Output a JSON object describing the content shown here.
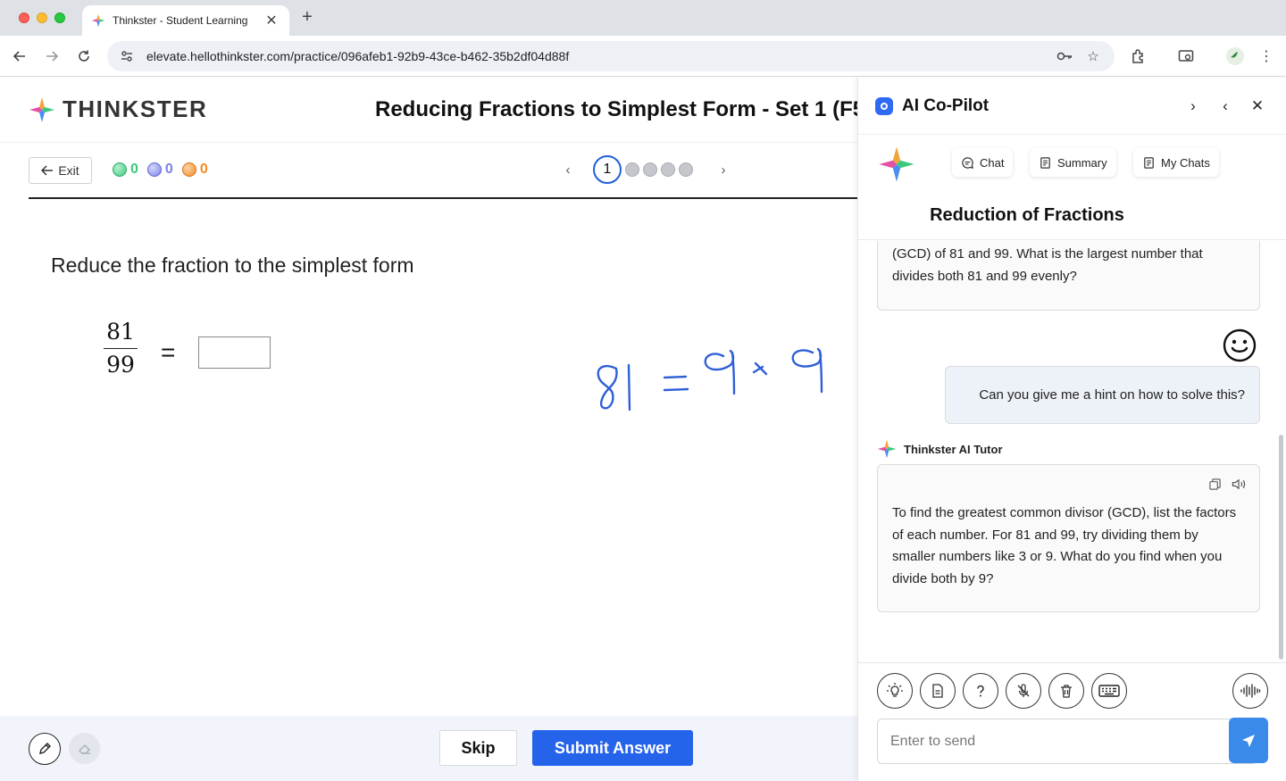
{
  "browser": {
    "tab_title": "Thinkster - Student Learning",
    "url": "elevate.hellothinkster.com/practice/096afeb1-92b9-43ce-b462-35b2df04d88f"
  },
  "header": {
    "logo_text": "THINKSTER",
    "title": "Reducing Fractions to Simplest Form - Set 1 (F5"
  },
  "controls": {
    "exit_label": "Exit",
    "scores": [
      {
        "value": "0",
        "color": "#3cc97b"
      },
      {
        "value": "0",
        "color": "#7b83e8"
      },
      {
        "value": "0",
        "color": "#f28a22"
      }
    ],
    "current_page": "1",
    "total_dots": 4
  },
  "question": {
    "prompt": "Reduce the fraction to the simplest form",
    "numerator": "81",
    "denominator": "99",
    "equals": "="
  },
  "footer": {
    "skip_label": "Skip",
    "submit_label": "Submit Answer"
  },
  "copilot": {
    "title": "AI Co-Pilot",
    "tabs": {
      "chat": "Chat",
      "summary": "Summary",
      "my_chats": "My Chats"
    },
    "conversation_title": "Reduction of Fractions",
    "messages": {
      "ai_first": "(GCD) of 81 and 99. What is the largest number that divides both 81 and 99 evenly?",
      "user": "Can you give me a hint on how to solve this?",
      "tutor_name": "Thinkster AI Tutor",
      "ai_reply": "To find the greatest common divisor (GCD), list the factors of each number. For 81 and 99, try dividing them by smaller numbers like 3 or 9. What do you find when you divide both by 9?"
    },
    "input_placeholder": "Enter to send"
  },
  "colors": {
    "accent": "#2563eb",
    "send": "#3a8be9",
    "ink": "#2f5fd6"
  }
}
